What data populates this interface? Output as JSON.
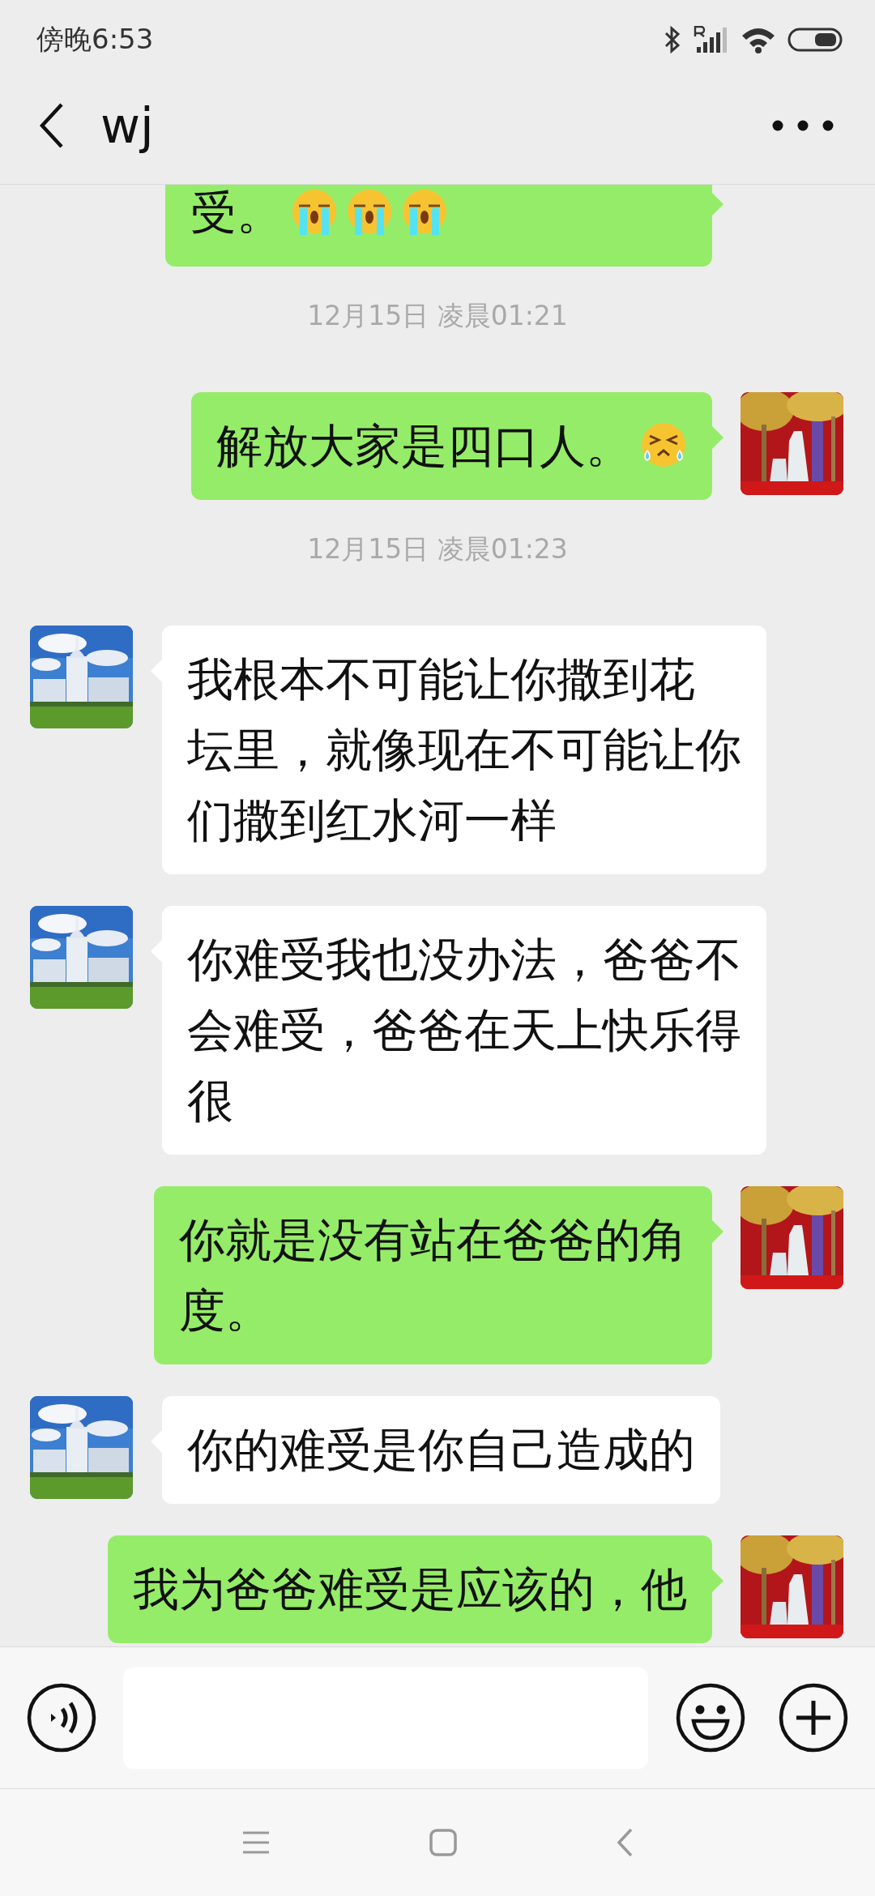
{
  "status_bar": {
    "time": "傍晚6:53"
  },
  "header": {
    "title": "wj"
  },
  "messages": [
    {
      "kind": "sent",
      "clipped_top": true,
      "lines": [
        "受。"
      ],
      "emojis": [
        {
          "kind": "loudly-crying"
        },
        {
          "kind": "loudly-crying"
        },
        {
          "kind": "loudly-crying"
        }
      ]
    },
    {
      "kind": "timestamp",
      "text": "12月15日 凌晨01:21"
    },
    {
      "kind": "sent",
      "clipped_top": false,
      "lines": [
        "解放大家是四口人。"
      ],
      "emojis": [
        {
          "kind": "squinting-tears"
        }
      ]
    },
    {
      "kind": "timestamp",
      "text": "12月15日 凌晨01:23"
    },
    {
      "kind": "received",
      "clipped_top": false,
      "lines": [
        "我根本不可能让你撒到花",
        "坛里，就像现在不可能让你",
        "们撒到红水河一样"
      ]
    },
    {
      "kind": "received",
      "clipped_top": false,
      "lines": [
        "你难受我也没办法，爸爸不",
        "会难受，爸爸在天上快乐得",
        "很"
      ]
    },
    {
      "kind": "sent",
      "clipped_top": false,
      "lines": [
        "你就是没有站在爸爸的角",
        "度。"
      ]
    },
    {
      "kind": "received",
      "clipped_top": false,
      "lines": [
        "你的难受是你自己造成的"
      ]
    },
    {
      "kind": "sent",
      "clipped_top": false,
      "lines": [
        "我为爸爸难受是应该的，他"
      ]
    }
  ]
}
